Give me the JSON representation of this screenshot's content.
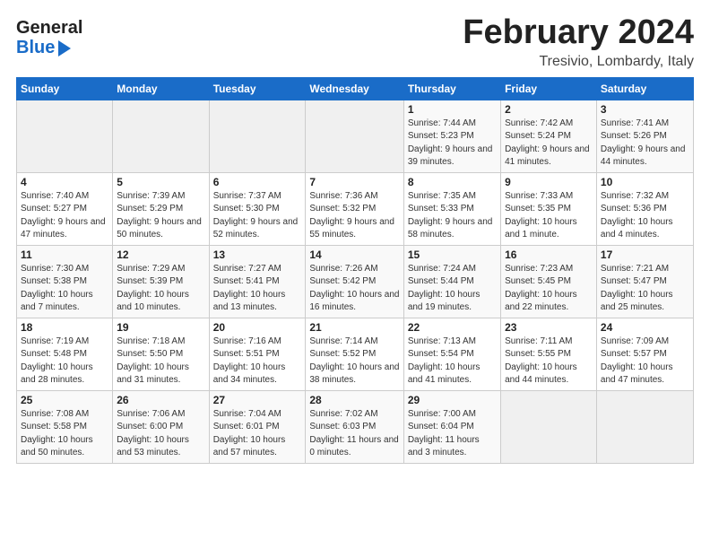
{
  "header": {
    "logo_general": "General",
    "logo_blue": "Blue",
    "month": "February 2024",
    "location": "Tresivio, Lombardy, Italy"
  },
  "weekdays": [
    "Sunday",
    "Monday",
    "Tuesday",
    "Wednesday",
    "Thursday",
    "Friday",
    "Saturday"
  ],
  "weeks": [
    [
      {
        "day": "",
        "info": ""
      },
      {
        "day": "",
        "info": ""
      },
      {
        "day": "",
        "info": ""
      },
      {
        "day": "",
        "info": ""
      },
      {
        "day": "1",
        "info": "Sunrise: 7:44 AM\nSunset: 5:23 PM\nDaylight: 9 hours\nand 39 minutes."
      },
      {
        "day": "2",
        "info": "Sunrise: 7:42 AM\nSunset: 5:24 PM\nDaylight: 9 hours\nand 41 minutes."
      },
      {
        "day": "3",
        "info": "Sunrise: 7:41 AM\nSunset: 5:26 PM\nDaylight: 9 hours\nand 44 minutes."
      }
    ],
    [
      {
        "day": "4",
        "info": "Sunrise: 7:40 AM\nSunset: 5:27 PM\nDaylight: 9 hours\nand 47 minutes."
      },
      {
        "day": "5",
        "info": "Sunrise: 7:39 AM\nSunset: 5:29 PM\nDaylight: 9 hours\nand 50 minutes."
      },
      {
        "day": "6",
        "info": "Sunrise: 7:37 AM\nSunset: 5:30 PM\nDaylight: 9 hours\nand 52 minutes."
      },
      {
        "day": "7",
        "info": "Sunrise: 7:36 AM\nSunset: 5:32 PM\nDaylight: 9 hours\nand 55 minutes."
      },
      {
        "day": "8",
        "info": "Sunrise: 7:35 AM\nSunset: 5:33 PM\nDaylight: 9 hours\nand 58 minutes."
      },
      {
        "day": "9",
        "info": "Sunrise: 7:33 AM\nSunset: 5:35 PM\nDaylight: 10 hours\nand 1 minute."
      },
      {
        "day": "10",
        "info": "Sunrise: 7:32 AM\nSunset: 5:36 PM\nDaylight: 10 hours\nand 4 minutes."
      }
    ],
    [
      {
        "day": "11",
        "info": "Sunrise: 7:30 AM\nSunset: 5:38 PM\nDaylight: 10 hours\nand 7 minutes."
      },
      {
        "day": "12",
        "info": "Sunrise: 7:29 AM\nSunset: 5:39 PM\nDaylight: 10 hours\nand 10 minutes."
      },
      {
        "day": "13",
        "info": "Sunrise: 7:27 AM\nSunset: 5:41 PM\nDaylight: 10 hours\nand 13 minutes."
      },
      {
        "day": "14",
        "info": "Sunrise: 7:26 AM\nSunset: 5:42 PM\nDaylight: 10 hours\nand 16 minutes."
      },
      {
        "day": "15",
        "info": "Sunrise: 7:24 AM\nSunset: 5:44 PM\nDaylight: 10 hours\nand 19 minutes."
      },
      {
        "day": "16",
        "info": "Sunrise: 7:23 AM\nSunset: 5:45 PM\nDaylight: 10 hours\nand 22 minutes."
      },
      {
        "day": "17",
        "info": "Sunrise: 7:21 AM\nSunset: 5:47 PM\nDaylight: 10 hours\nand 25 minutes."
      }
    ],
    [
      {
        "day": "18",
        "info": "Sunrise: 7:19 AM\nSunset: 5:48 PM\nDaylight: 10 hours\nand 28 minutes."
      },
      {
        "day": "19",
        "info": "Sunrise: 7:18 AM\nSunset: 5:50 PM\nDaylight: 10 hours\nand 31 minutes."
      },
      {
        "day": "20",
        "info": "Sunrise: 7:16 AM\nSunset: 5:51 PM\nDaylight: 10 hours\nand 34 minutes."
      },
      {
        "day": "21",
        "info": "Sunrise: 7:14 AM\nSunset: 5:52 PM\nDaylight: 10 hours\nand 38 minutes."
      },
      {
        "day": "22",
        "info": "Sunrise: 7:13 AM\nSunset: 5:54 PM\nDaylight: 10 hours\nand 41 minutes."
      },
      {
        "day": "23",
        "info": "Sunrise: 7:11 AM\nSunset: 5:55 PM\nDaylight: 10 hours\nand 44 minutes."
      },
      {
        "day": "24",
        "info": "Sunrise: 7:09 AM\nSunset: 5:57 PM\nDaylight: 10 hours\nand 47 minutes."
      }
    ],
    [
      {
        "day": "25",
        "info": "Sunrise: 7:08 AM\nSunset: 5:58 PM\nDaylight: 10 hours\nand 50 minutes."
      },
      {
        "day": "26",
        "info": "Sunrise: 7:06 AM\nSunset: 6:00 PM\nDaylight: 10 hours\nand 53 minutes."
      },
      {
        "day": "27",
        "info": "Sunrise: 7:04 AM\nSunset: 6:01 PM\nDaylight: 10 hours\nand 57 minutes."
      },
      {
        "day": "28",
        "info": "Sunrise: 7:02 AM\nSunset: 6:03 PM\nDaylight: 11 hours\nand 0 minutes."
      },
      {
        "day": "29",
        "info": "Sunrise: 7:00 AM\nSunset: 6:04 PM\nDaylight: 11 hours\nand 3 minutes."
      },
      {
        "day": "",
        "info": ""
      },
      {
        "day": "",
        "info": ""
      }
    ]
  ]
}
